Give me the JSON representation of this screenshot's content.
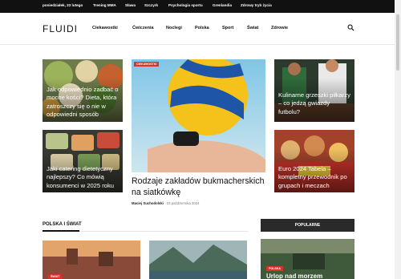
{
  "topbar": {
    "items": [
      "poniedziałek, 23 lutego",
      "Trening MMA",
      "Sława",
      "Szczyrk",
      "Psychologia sportu",
      "Grenlandia",
      "Zdrowy tryb życia"
    ]
  },
  "header": {
    "logo": "FLUIDI",
    "nav": [
      "Ciekawostki",
      "Ćwiczenia",
      "Noclegi",
      "Polska",
      "Sport",
      "Świat",
      "Zdrowie"
    ]
  },
  "hero": {
    "left_top_title": "Jak odpowiednio zadbać o mocne kości? Dieta, która zatroszczy się o nie w odpowiedni sposób",
    "left_bottom_title": "Jaki catering dietetyczny najlepszy? Co mówią konsumenci w 2025 roku",
    "main_badge": "CIEKAWOSTKI",
    "main_title": "Rodzaje zakładów bukmacherskich na siatkówkę",
    "main_author": "Maciej Suchodolski",
    "main_date": "23 października 2024",
    "right_top_title": "Kulinarne grzeszki piłkarzy – co jedzą gwiazdy futbolu?",
    "right_bottom_title": "Euro 2024 Tabela – kompletny przewodnik po grupach i meczach"
  },
  "sections": {
    "polska_swiat": "POLSKA I ŚWIAT",
    "popularne": "POPULARNE",
    "card1_badge": "ŚWIAT",
    "popular_badge": "POLSKA",
    "popular_title_partial": "Urlop nad morzem"
  },
  "colors": {
    "accent": "#d6332a",
    "topbar": "#111111"
  }
}
